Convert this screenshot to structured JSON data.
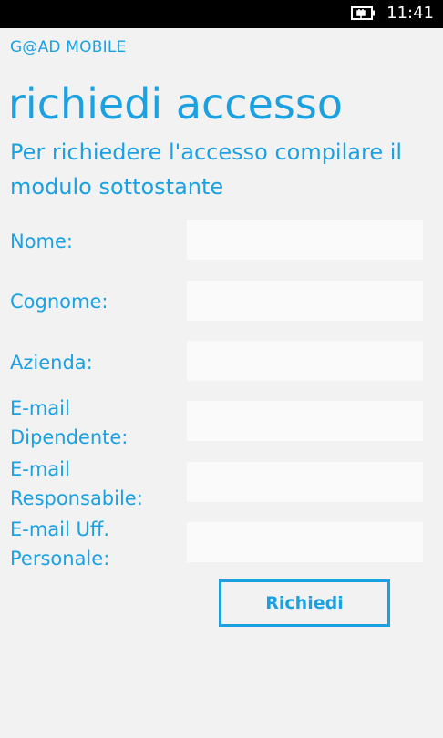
{
  "status_bar": {
    "time": "11:41",
    "battery_icon": "battery-charging-icon"
  },
  "app_name": "G@AD MOBILE",
  "page_title": "richiedi accesso",
  "subtitle": "Per richiedere l'accesso compilare il modulo sottostante",
  "fields": [
    {
      "label": "Nome:",
      "value": "",
      "placeholder": ""
    },
    {
      "label": "Cognome:",
      "value": "",
      "placeholder": ""
    },
    {
      "label": "Azienda:",
      "value": "",
      "placeholder": ""
    },
    {
      "label": "E-mail Dipendente:",
      "value": "",
      "placeholder": ""
    },
    {
      "label": "E-mail Responsabile:",
      "value": "",
      "placeholder": ""
    },
    {
      "label": "E-mail Uff. Personale:",
      "value": "",
      "placeholder": ""
    }
  ],
  "submit_label": "Richiedi",
  "colors": {
    "accent": "#1ba1e2",
    "background": "#f2f2f2",
    "input_background": "#fafafa"
  }
}
